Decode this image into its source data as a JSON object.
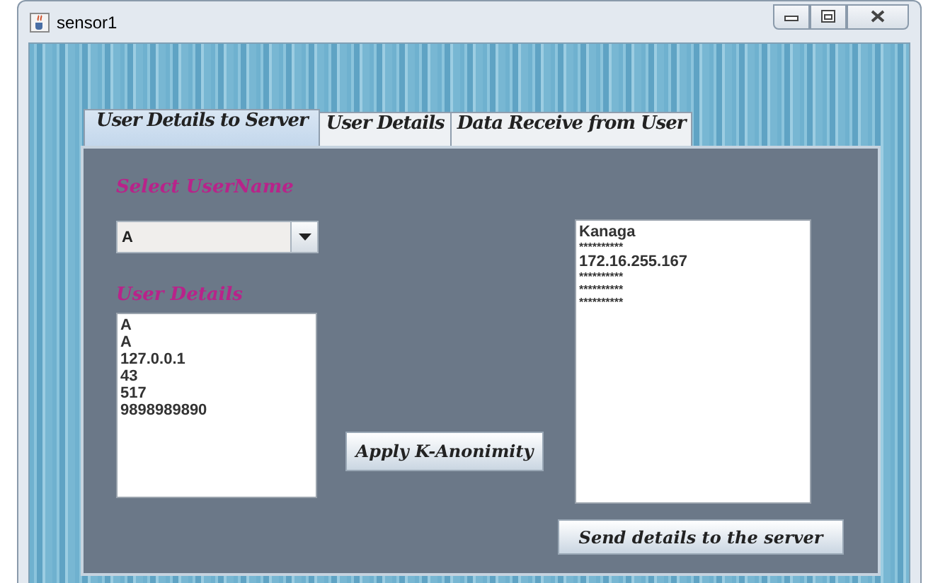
{
  "window": {
    "title": "sensor1"
  },
  "tabs": [
    {
      "label": "User Details to Server",
      "selected": true
    },
    {
      "label": "User Details",
      "selected": false
    },
    {
      "label": "Data Receive from User",
      "selected": false
    }
  ],
  "select_username": {
    "label": "Select UserName",
    "value": "A"
  },
  "user_details": {
    "label": "User Details",
    "lines": [
      "A",
      "A",
      "127.0.0.1",
      "43",
      "517",
      "9898989890"
    ]
  },
  "apply_button": "Apply K-Anonimity",
  "result_list": {
    "lines": [
      {
        "text": "Kanaga",
        "kind": "value"
      },
      {
        "text": "**********",
        "kind": "masked"
      },
      {
        "text": "172.16.255.167",
        "kind": "value"
      },
      {
        "text": "**********",
        "kind": "masked"
      },
      {
        "text": "**********",
        "kind": "masked"
      },
      {
        "text": "**********",
        "kind": "masked"
      }
    ]
  },
  "send_button": "Send details to the server"
}
